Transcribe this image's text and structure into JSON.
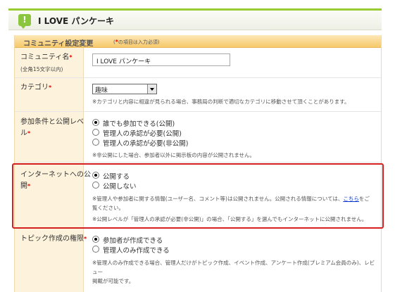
{
  "header": {
    "title": "I LOVE パンケーキ"
  },
  "section": {
    "title": "コミュニティ設定変更",
    "required_note_star": "*",
    "required_note": "の項目は入力必須)",
    "required_note_prefix": "("
  },
  "community_name": {
    "label": "コミュニティ名",
    "sublabel": "(全角15文字以内)",
    "value": "I LOVE パンケーキ"
  },
  "category": {
    "label": "カテゴリ",
    "selected": "趣味",
    "note": "※カテゴリと内容に相違が見られる場合、事務局の判断で適切なカテゴリに移動させて頂くことがあります。"
  },
  "participation": {
    "label_line1": "参加条件と公開レベ",
    "label_line2": "ル",
    "options": [
      "誰でも参加できる(公開)",
      "管理人の承認が必要(公開)",
      "管理人の承認が必要(非公開)"
    ],
    "selected_index": 0,
    "note": "※非公開にした場合、参加者以外に掲示板の内容が公開されません。"
  },
  "internet_publish": {
    "label_line1": "インターネットへの公",
    "label_line2": "開",
    "options": [
      "公開する",
      "公開しない"
    ],
    "selected_index": 0,
    "note1_before": "※管理人や参加者に関する情報(ユーザー名、コメント等)は公開されません。公開される情報については、",
    "note1_link": "こちら",
    "note1_after": "をご",
    "note1_line2": "覧ください。",
    "note2": "※公開レベルが「管理人の承認が必要(非公開)」の場合、「公開する」を選んでもインターネットに公開されません。"
  },
  "topic_permission": {
    "label": "トピック作成の権限",
    "options": [
      "参加者が作成できる",
      "管理人のみ作成できる"
    ],
    "selected_index": 0,
    "note_line1": "※管理人のみ作成できる場合、管理人だけがトピック作成、イベント作成、アンケート作成(プレミアム会員のみ)、レビュー",
    "note_line2": "掲載が可能です。"
  },
  "colors": {
    "accent_green": "#99cc33",
    "section_orange": "#f7c96b",
    "label_bg": "#fdf3dc",
    "required_red": "#e60000",
    "highlight_red": "#d62020",
    "link_blue": "#0033cc"
  }
}
